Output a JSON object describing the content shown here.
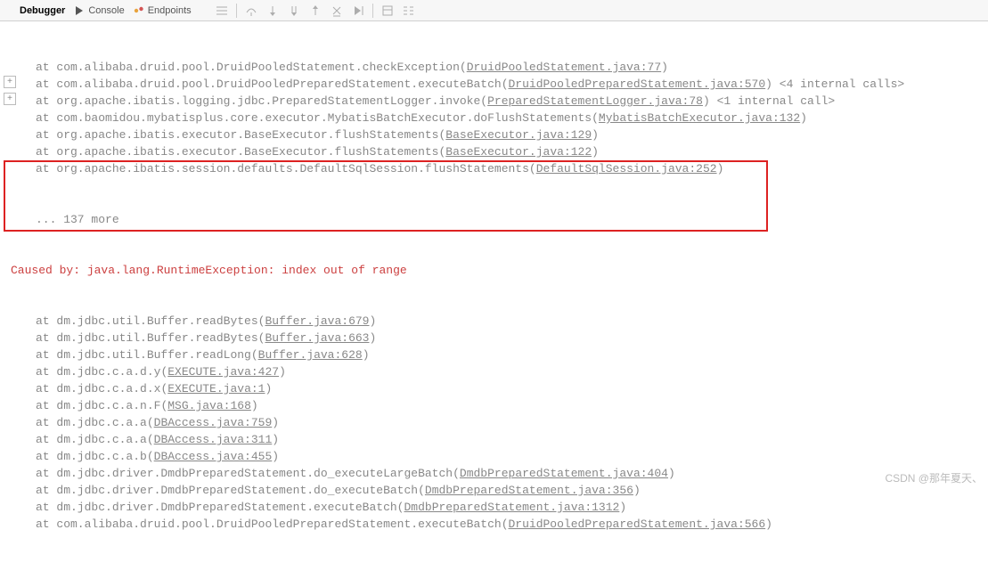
{
  "tabs": {
    "debugger": "Debugger",
    "console": "Console",
    "endpoints": "Endpoints"
  },
  "gutter_glyph": "+",
  "lines": [
    {
      "gutter": false,
      "at": "at",
      "pkg": "com.alibaba.druid.pool.DruidPooledStatement.checkException",
      "link": "DruidPooledStatement.java:77",
      "calls": ""
    },
    {
      "gutter": true,
      "at": "at",
      "pkg": "com.alibaba.druid.pool.DruidPooledPreparedStatement.executeBatch",
      "link": "DruidPooledPreparedStatement.java:570",
      "calls": "<4 internal calls>"
    },
    {
      "gutter": true,
      "at": "at",
      "pkg": "org.apache.ibatis.logging.jdbc.PreparedStatementLogger.invoke",
      "link": "PreparedStatementLogger.java:78",
      "calls": "<1 internal call>"
    },
    {
      "gutter": false,
      "at": "at",
      "pkg": "com.baomidou.mybatisplus.core.executor.MybatisBatchExecutor.doFlushStatements",
      "link": "MybatisBatchExecutor.java:132",
      "calls": ""
    },
    {
      "gutter": false,
      "at": "at",
      "pkg": "org.apache.ibatis.executor.BaseExecutor.flushStatements",
      "link": "BaseExecutor.java:129",
      "calls": ""
    },
    {
      "gutter": false,
      "at": "at",
      "pkg": "org.apache.ibatis.executor.BaseExecutor.flushStatements",
      "link": "BaseExecutor.java:122",
      "calls": ""
    },
    {
      "gutter": false,
      "at": "at",
      "pkg": "org.apache.ibatis.session.defaults.DefaultSqlSession.flushStatements",
      "link": "DefaultSqlSession.java:252",
      "calls": ""
    }
  ],
  "more_text": "... 137 more",
  "caused_by": "Caused by: java.lang.RuntimeException: index out of range",
  "lines2": [
    {
      "at": "at",
      "pkg": "dm.jdbc.util.Buffer.readBytes",
      "link": "Buffer.java:679"
    },
    {
      "at": "at",
      "pkg": "dm.jdbc.util.Buffer.readBytes",
      "link": "Buffer.java:663"
    },
    {
      "at": "at",
      "pkg": "dm.jdbc.util.Buffer.readLong",
      "link": "Buffer.java:628"
    },
    {
      "at": "at",
      "pkg": "dm.jdbc.c.a.d.y",
      "link": "EXECUTE.java:427"
    },
    {
      "at": "at",
      "pkg": "dm.jdbc.c.a.d.x",
      "link": "EXECUTE.java:1"
    },
    {
      "at": "at",
      "pkg": "dm.jdbc.c.a.n.F",
      "link": "MSG.java:168"
    },
    {
      "at": "at",
      "pkg": "dm.jdbc.c.a.a",
      "link": "DBAccess.java:759"
    },
    {
      "at": "at",
      "pkg": "dm.jdbc.c.a.a",
      "link": "DBAccess.java:311"
    },
    {
      "at": "at",
      "pkg": "dm.jdbc.c.a.b",
      "link": "DBAccess.java:455"
    },
    {
      "at": "at",
      "pkg": "dm.jdbc.driver.DmdbPreparedStatement.do_executeLargeBatch",
      "link": "DmdbPreparedStatement.java:404"
    },
    {
      "at": "at",
      "pkg": "dm.jdbc.driver.DmdbPreparedStatement.do_executeBatch",
      "link": "DmdbPreparedStatement.java:356"
    },
    {
      "at": "at",
      "pkg": "dm.jdbc.driver.DmdbPreparedStatement.executeBatch",
      "link": "DmdbPreparedStatement.java:1312"
    },
    {
      "at": "at",
      "pkg": "com.alibaba.druid.pool.DruidPooledPreparedStatement.executeBatch",
      "link": "DruidPooledPreparedStatement.java:566"
    }
  ],
  "watermark": "CSDN @那年夏天、"
}
